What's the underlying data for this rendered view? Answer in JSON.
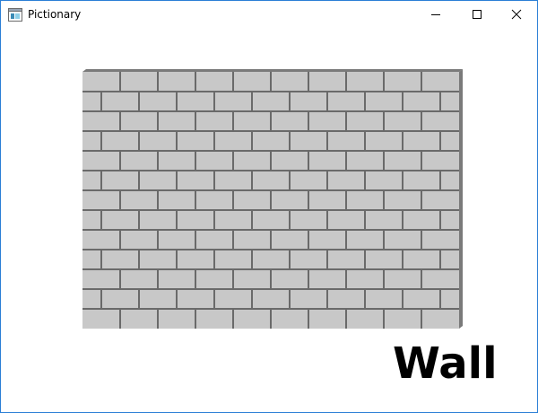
{
  "window": {
    "title": "Pictionary",
    "accent_color": "#2b7fd6"
  },
  "titlebar": {
    "app_icon": "app-window-icon",
    "buttons": [
      {
        "name": "minimize-icon"
      },
      {
        "name": "maximize-icon"
      },
      {
        "name": "close-icon"
      }
    ]
  },
  "picture": {
    "subject": "brick-wall",
    "colors": {
      "brick": "#c8c8c8",
      "mortar": "#6a6a6a",
      "shadow": "#7a7a7a"
    }
  },
  "caption": {
    "word": "Wall"
  }
}
